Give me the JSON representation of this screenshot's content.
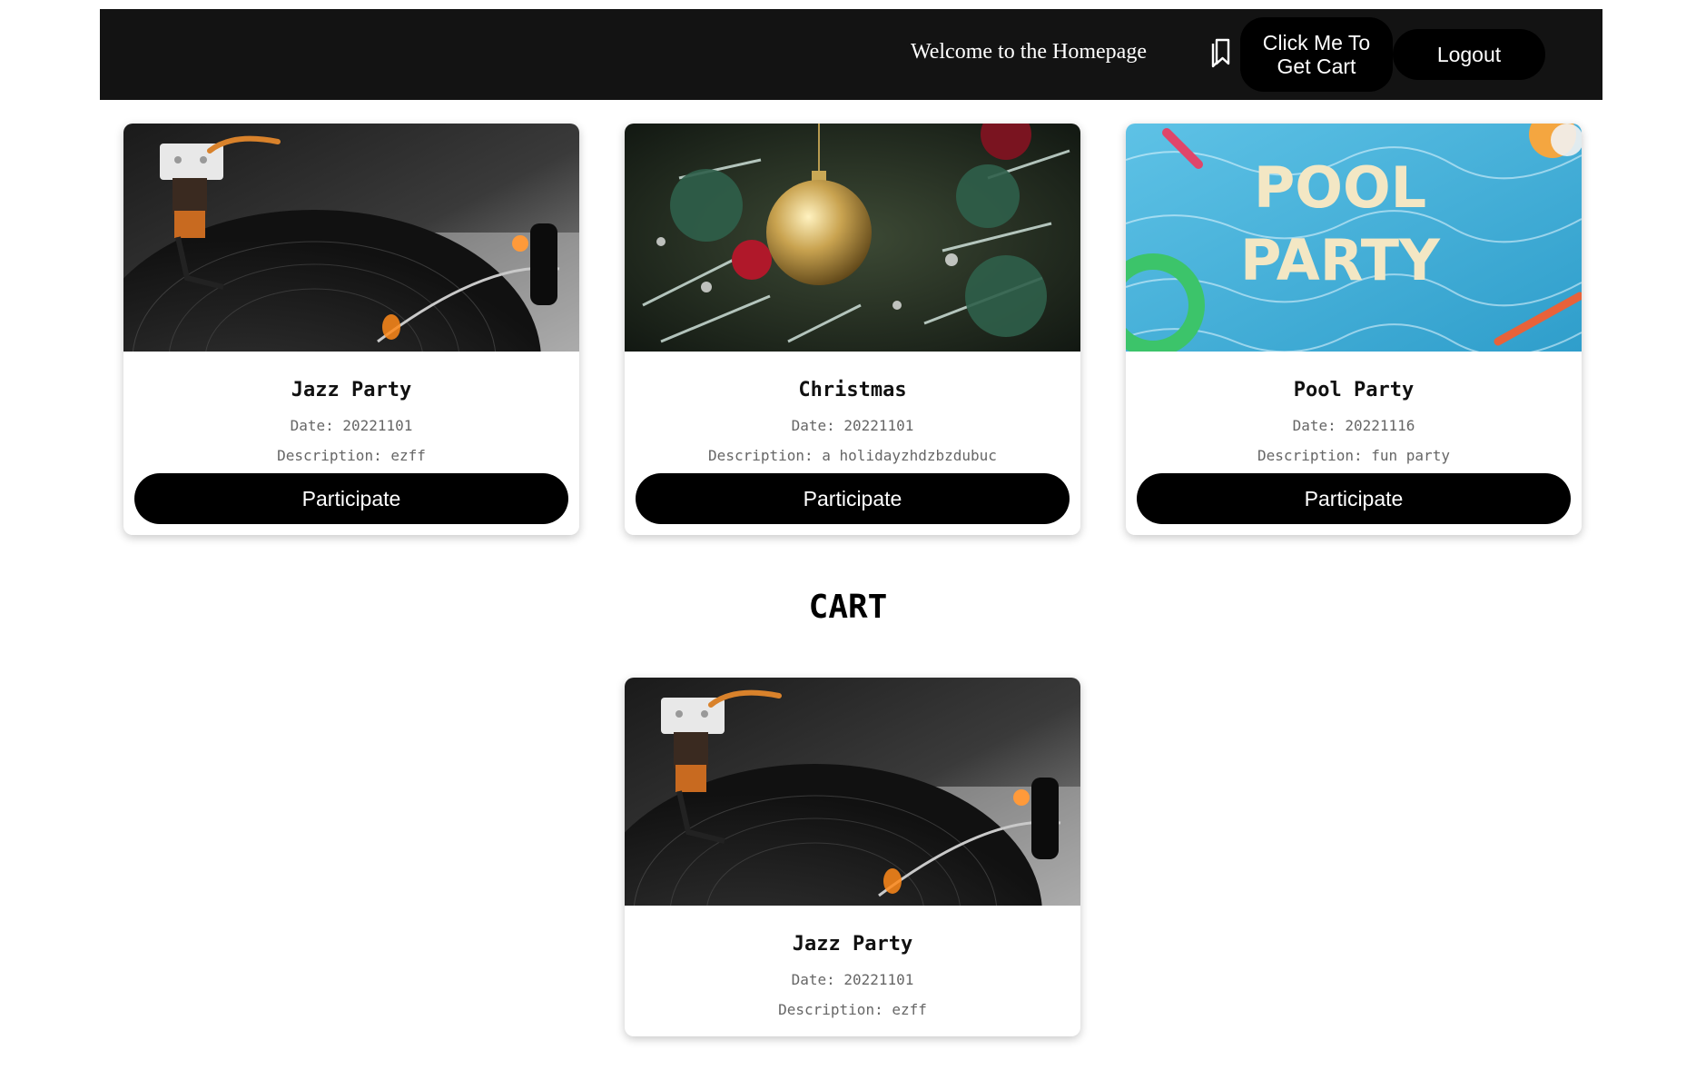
{
  "header": {
    "welcome_text": "Welcome to the Homepage",
    "bookmark_icon": "bookmark-icon",
    "cart_button_label": "Click Me To Get Cart",
    "logout_button_label": "Logout",
    "background_color": "#131313"
  },
  "events": [
    {
      "title": "Jazz Party",
      "date": "Date: 20221101",
      "description": "Description: ezff",
      "button_label": "Participate",
      "image": "turntable"
    },
    {
      "title": "Christmas",
      "date": "Date: 20221101",
      "description": "Description: a holidayzhdzbzdubuc",
      "button_label": "Participate",
      "image": "christmas-ornament"
    },
    {
      "title": "Pool Party",
      "date": "Date: 20221116",
      "description": "Description: fun party",
      "button_label": "Participate",
      "image": "pool-party",
      "image_text": [
        "POOL",
        "PARTY"
      ]
    }
  ],
  "cart": {
    "heading": "CART",
    "items": [
      {
        "title": "Jazz Party",
        "date": "Date: 20221101",
        "description": "Description: ezff",
        "image": "turntable"
      }
    ]
  }
}
